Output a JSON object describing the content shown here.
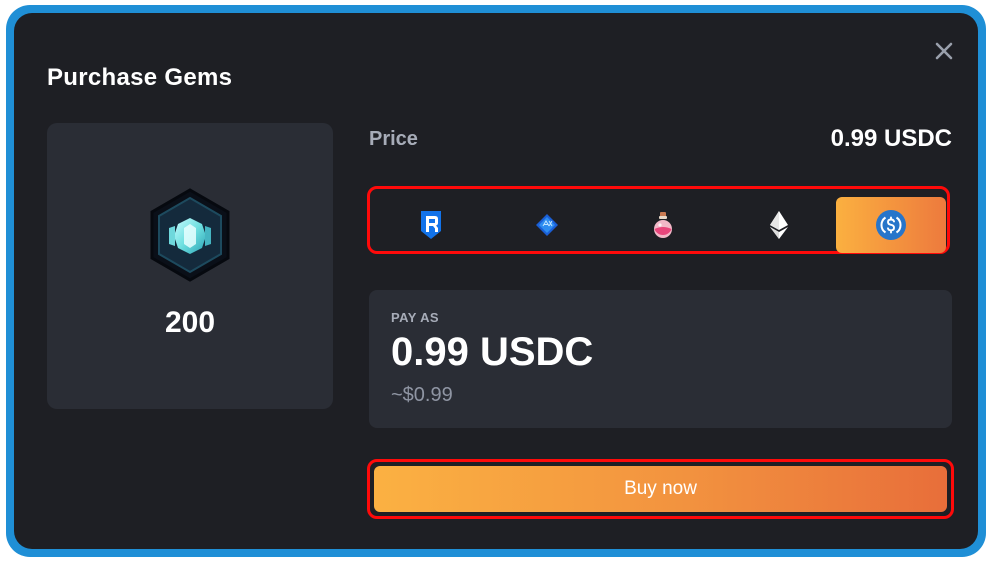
{
  "modal": {
    "title": "Purchase Gems",
    "close_icon": "close-icon"
  },
  "item": {
    "icon": "gem-icon",
    "quantity": "200"
  },
  "price": {
    "label": "Price",
    "value": "0.99 USDC"
  },
  "tokens": [
    {
      "name": "ronin-icon",
      "selected": false
    },
    {
      "name": "axs-icon",
      "selected": false
    },
    {
      "name": "potion-icon",
      "selected": false
    },
    {
      "name": "ethereum-icon",
      "selected": false
    },
    {
      "name": "usdc-icon",
      "selected": true
    }
  ],
  "pay": {
    "label": "PAY AS",
    "amount": "0.99 USDC",
    "usd_equivalent": "~$0.99"
  },
  "buy": {
    "label": "Buy now"
  },
  "colors": {
    "frame": "#1f8fd6",
    "background": "#1e1f24",
    "card": "#2a2d35",
    "accent_start": "#fbb040",
    "accent_end": "#e86e3a",
    "highlight_outline": "#ff0a0a"
  }
}
